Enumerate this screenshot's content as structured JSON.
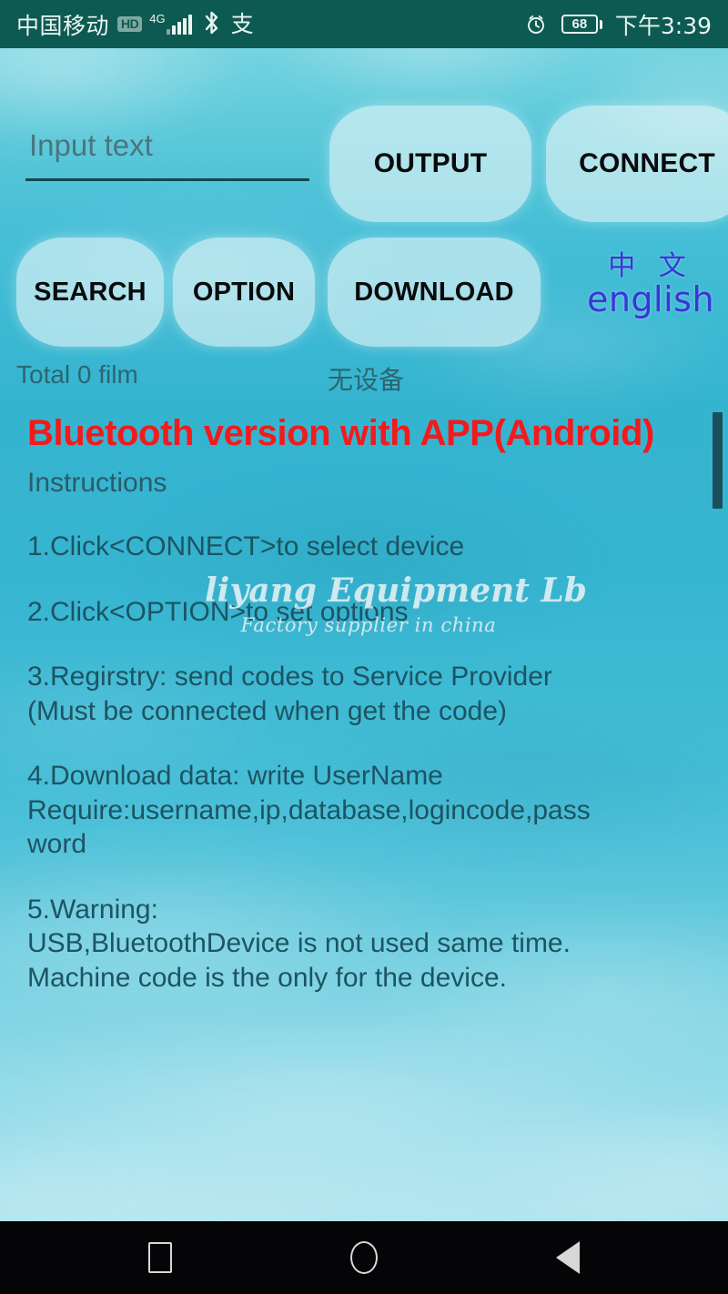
{
  "status_bar": {
    "carrier": "中国移动",
    "hd_badge": "HD",
    "network": "4G",
    "signal_icon": "signal-bars-icon",
    "bluetooth_icon": "bluetooth-icon",
    "alipay_icon": "alipay-icon",
    "alipay_glyph": "支",
    "alarm_icon": "alarm-clock-icon",
    "battery_level": "68",
    "time": "下午3:39"
  },
  "app": {
    "input": {
      "placeholder": "Input text",
      "value": ""
    },
    "buttons": {
      "output": "OUTPUT",
      "connect": "CONNECT",
      "search": "SEARCH",
      "option": "OPTION",
      "download": "DOWNLOAD"
    },
    "language_toggle": {
      "chinese": "中 文",
      "english": "english",
      "accent_color": "#3a36d6"
    },
    "status": {
      "total_film": "Total 0 film",
      "device_state": "无设备"
    },
    "content": {
      "headline": "Bluetooth version with APP(Android)",
      "headline_color": "#f5191b",
      "subtitle": "Instructions",
      "instructions": [
        "1.Click<CONNECT>to select device",
        "2.Click<OPTION>to set options",
        "3.Regirstry: send codes to Service Provider\n(Must be connected when get the code)",
        "4.Download data: write UserName\nRequire:username,ip,database,logincode,pass\nword",
        "5.Warning:\nUSB,BluetoothDevice is not used same time.\nMachine code is the only for the device."
      ]
    },
    "watermark": {
      "main": "liyang Equipment Lb",
      "sub": "Factory supplier in china"
    }
  },
  "nav_bar": {
    "recents_icon": "recents-square-icon",
    "home_icon": "home-circle-icon",
    "back_icon": "back-triangle-icon"
  }
}
